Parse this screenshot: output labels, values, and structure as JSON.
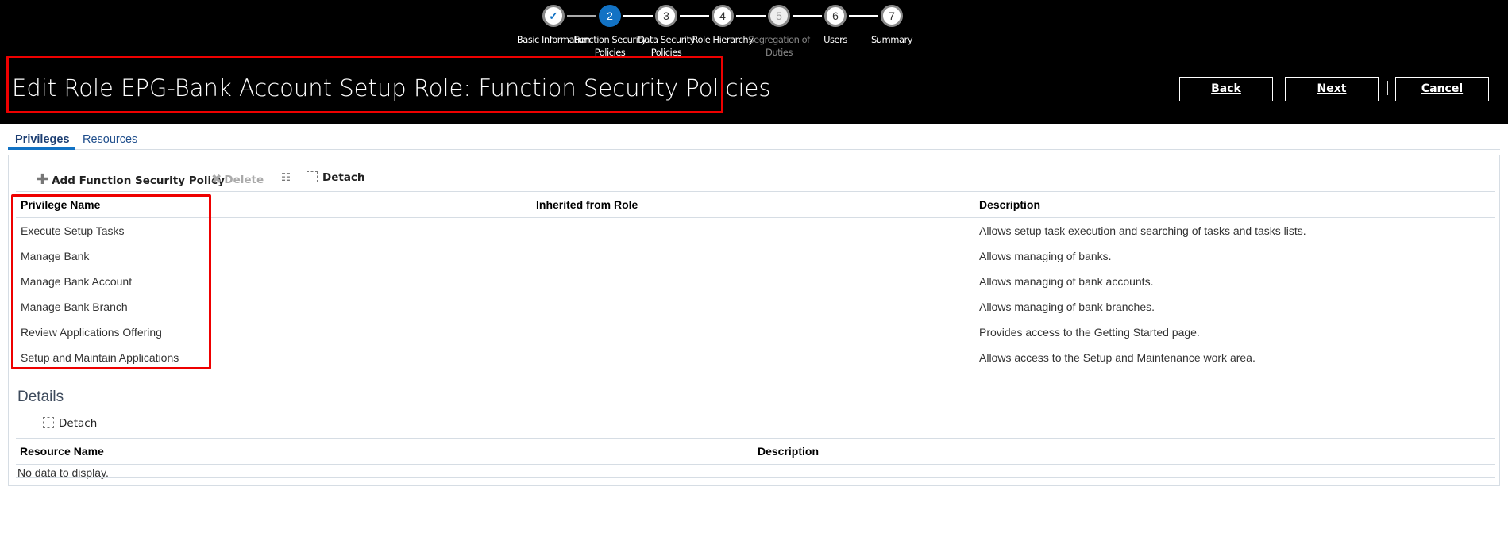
{
  "train": {
    "steps": [
      {
        "num": "✓",
        "label": "Basic Information",
        "state": "done"
      },
      {
        "num": "2",
        "label": "Function Security Policies",
        "state": "current"
      },
      {
        "num": "3",
        "label": "Data Security Policies",
        "state": "normal"
      },
      {
        "num": "4",
        "label": "Role Hierarchy",
        "state": "normal"
      },
      {
        "num": "5",
        "label": "Segregation of Duties",
        "state": "disabled"
      },
      {
        "num": "6",
        "label": "Users",
        "state": "normal"
      },
      {
        "num": "7",
        "label": "Summary",
        "state": "normal"
      }
    ]
  },
  "header": {
    "title": "Edit Role EPG-Bank Account Setup Role: Function Security Policies",
    "back": "Back",
    "next": "Next",
    "cancel": "Cancel"
  },
  "tabs": [
    "Privileges",
    "Resources"
  ],
  "toolbar": {
    "add": "Add Function Security Policy",
    "delete": "Delete",
    "detach": "Detach"
  },
  "table": {
    "columns": [
      "Privilege Name",
      "Inherited from Role",
      "Description"
    ],
    "rows": [
      {
        "name": "Execute Setup Tasks",
        "inherited": "",
        "description": "Allows setup task execution and searching of tasks and tasks lists."
      },
      {
        "name": "Manage Bank",
        "inherited": "",
        "description": "Allows managing of banks."
      },
      {
        "name": "Manage Bank Account",
        "inherited": "",
        "description": "Allows managing of bank accounts."
      },
      {
        "name": "Manage Bank Branch",
        "inherited": "",
        "description": "Allows managing of bank branches."
      },
      {
        "name": "Review Applications Offering",
        "inherited": "",
        "description": "Provides access to the Getting Started page."
      },
      {
        "name": "Setup and Maintain Applications",
        "inherited": "",
        "description": "Allows access to the Setup and Maintenance work area."
      }
    ]
  },
  "details": {
    "title": "Details",
    "detach": "Detach",
    "columns": [
      "Resource Name",
      "Description"
    ],
    "empty": "No data to display."
  },
  "colors": {
    "accent": "#1272c4",
    "highlight": "#e00000"
  }
}
